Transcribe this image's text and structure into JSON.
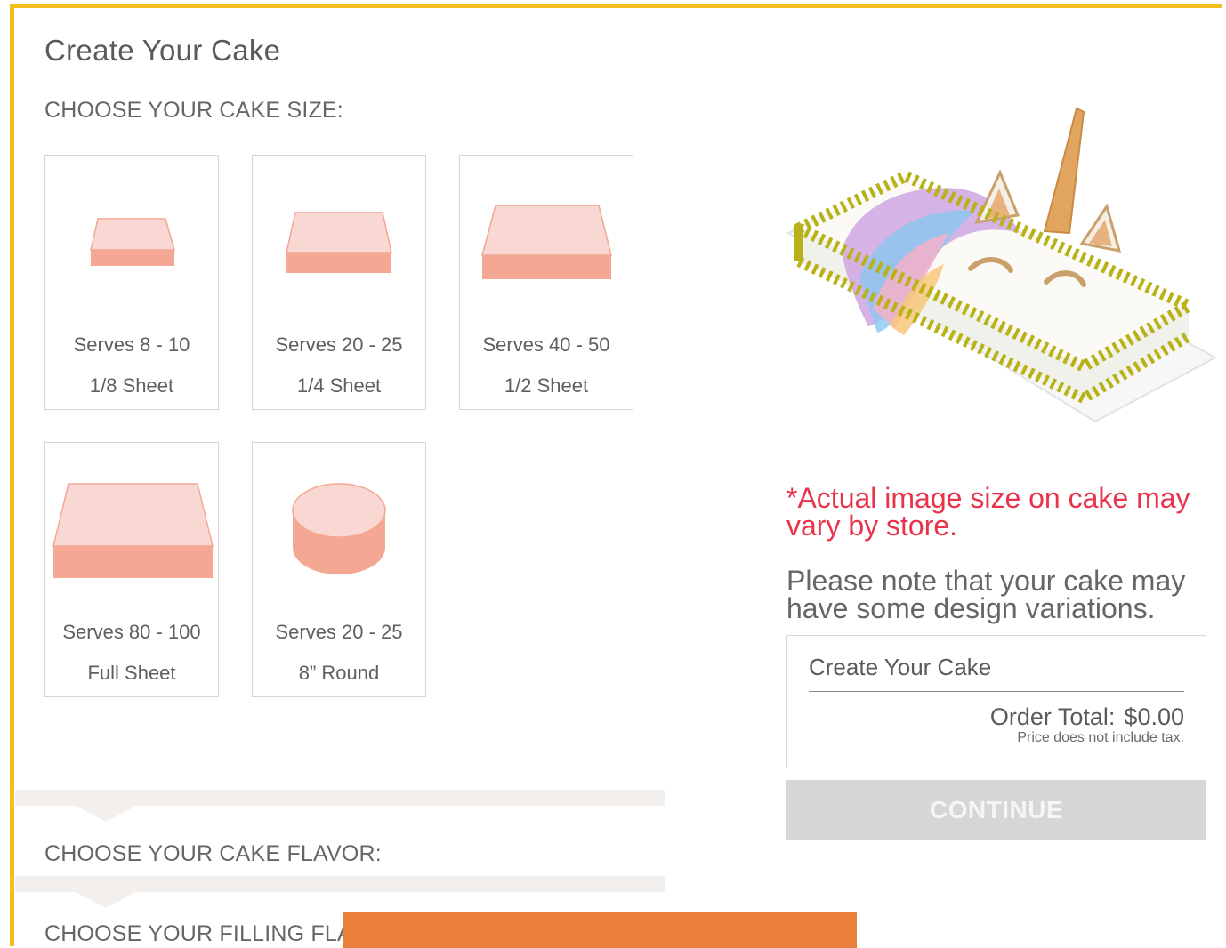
{
  "page": {
    "title": "Create Your Cake"
  },
  "sections": {
    "size_label": "CHOOSE YOUR CAKE SIZE:",
    "flavor_label": "CHOOSE YOUR CAKE FLAVOR:",
    "filling_label": "CHOOSE YOUR FILLING FLAVOR:"
  },
  "sizes": [
    {
      "serves": "Serves 8 - 10",
      "name": "1/8 Sheet",
      "icon": "sheet-cake-icon"
    },
    {
      "serves": "Serves 20 - 25",
      "name": "1/4 Sheet",
      "icon": "sheet-cake-icon"
    },
    {
      "serves": "Serves 40 - 50",
      "name": "1/2 Sheet",
      "icon": "sheet-cake-icon"
    },
    {
      "serves": "Serves 80 - 100",
      "name": "Full Sheet",
      "icon": "sheet-cake-icon"
    },
    {
      "serves": "Serves 20 - 25",
      "name": "8” Round",
      "icon": "round-cake-icon"
    }
  ],
  "preview": {
    "disclaimer": "*Actual image size on cake may vary by store.",
    "note": "Please note that your cake may have some design variations."
  },
  "summary": {
    "title": "Create Your Cake",
    "total_label": "Order Total:",
    "total_value": "$0.00",
    "tax_note": "Price does not include tax."
  },
  "actions": {
    "continue_label": "CONTINUE"
  },
  "colors": {
    "accent_border": "#f2c01e",
    "disclaimer_red": "#e8334a",
    "cake_top": "#f9d7d2",
    "cake_side": "#f4a793",
    "button_disabled": "#d6d6d6",
    "orange_bar": "#e97f3a"
  }
}
